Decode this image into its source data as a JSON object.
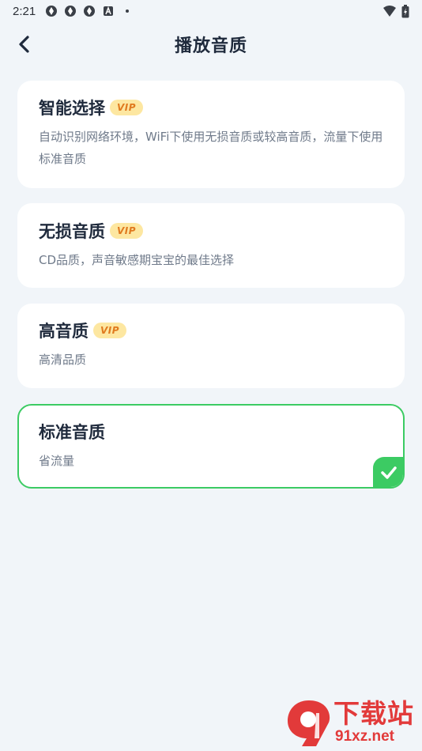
{
  "status_bar": {
    "time": "2:21",
    "left_icons": [
      "settings-sync-icon",
      "settings-sync-icon",
      "settings-sync-icon",
      "app-a-icon",
      "dot-icon"
    ],
    "right_icons": [
      "wifi-icon",
      "battery-icon"
    ]
  },
  "header": {
    "title": "播放音质",
    "back_icon": "chevron-left-icon"
  },
  "options": [
    {
      "title": "智能选择",
      "vip": "VIP",
      "desc": "自动识别网络环境，WiFi下使用无损音质或较高音质，流量下使用标准音质",
      "selected": false
    },
    {
      "title": "无损音质",
      "vip": "VIP",
      "desc": "CD品质，声音敏感期宝宝的最佳选择",
      "selected": false
    },
    {
      "title": "高音质",
      "vip": "VIP",
      "desc": "高清品质",
      "selected": false
    },
    {
      "title": "标准音质",
      "vip": "",
      "desc": "省流量",
      "selected": true
    }
  ],
  "watermark": {
    "title": "下载站",
    "url": "91xz.net"
  },
  "colors": {
    "background": "#f1f5f9",
    "card": "#ffffff",
    "selected_border": "#3ccb63",
    "vip_bg": "#fde7a1",
    "vip_text": "#e07a1f",
    "watermark": "#e23a3a"
  }
}
